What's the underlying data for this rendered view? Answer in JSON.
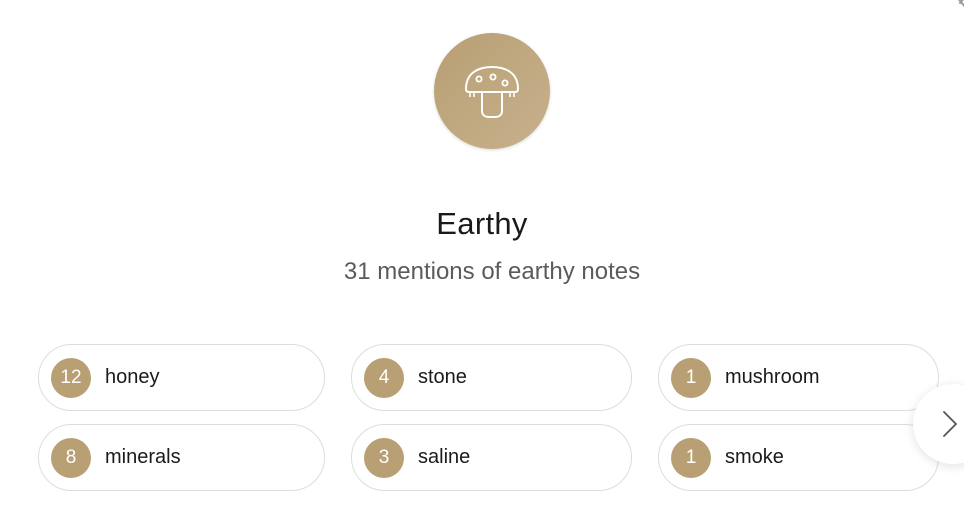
{
  "category": {
    "icon": "mushroom-icon",
    "title": "Earthy",
    "subtitle": "31 mentions of earthy notes"
  },
  "notes": [
    {
      "count": "12",
      "label": "honey"
    },
    {
      "count": "4",
      "label": "stone"
    },
    {
      "count": "1",
      "label": "mushroom"
    },
    {
      "count": "8",
      "label": "minerals"
    },
    {
      "count": "3",
      "label": "saline"
    },
    {
      "count": "1",
      "label": "smoke"
    }
  ],
  "colors": {
    "accent": "#b89f74",
    "pill_border": "#dddddd",
    "subtitle": "#5b5b5b"
  },
  "controls": {
    "next_icon": "chevron-right-icon"
  }
}
